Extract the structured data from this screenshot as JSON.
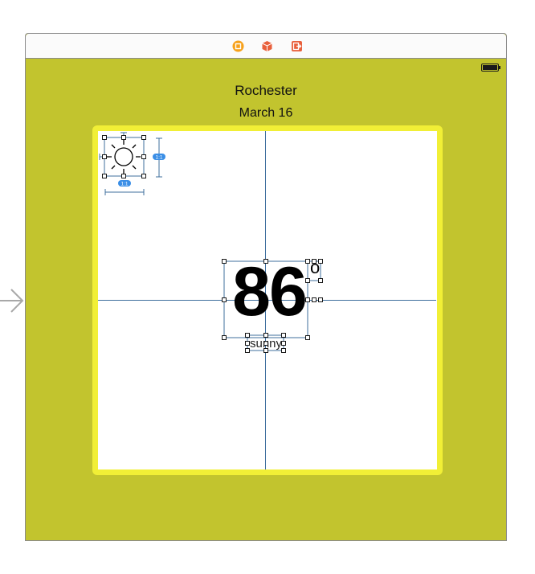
{
  "location": {
    "city": "Rochester"
  },
  "date": "March 16",
  "weather": {
    "temperature": "86",
    "degree_symbol": "o",
    "condition": "sunny"
  },
  "constraints": {
    "aspect_ratio_label": "1:1",
    "aspect_ratio_label_2": "1:1"
  },
  "scene_dock": {
    "icons": [
      "view-controller-icon",
      "first-responder-icon",
      "exit-icon"
    ]
  },
  "colors": {
    "scene_background": "#c2c42e",
    "card_border": "#f1ef36",
    "guide": "#3f6f9e",
    "dock_orange": "#f7a11b",
    "dock_red": "#e8603c"
  }
}
